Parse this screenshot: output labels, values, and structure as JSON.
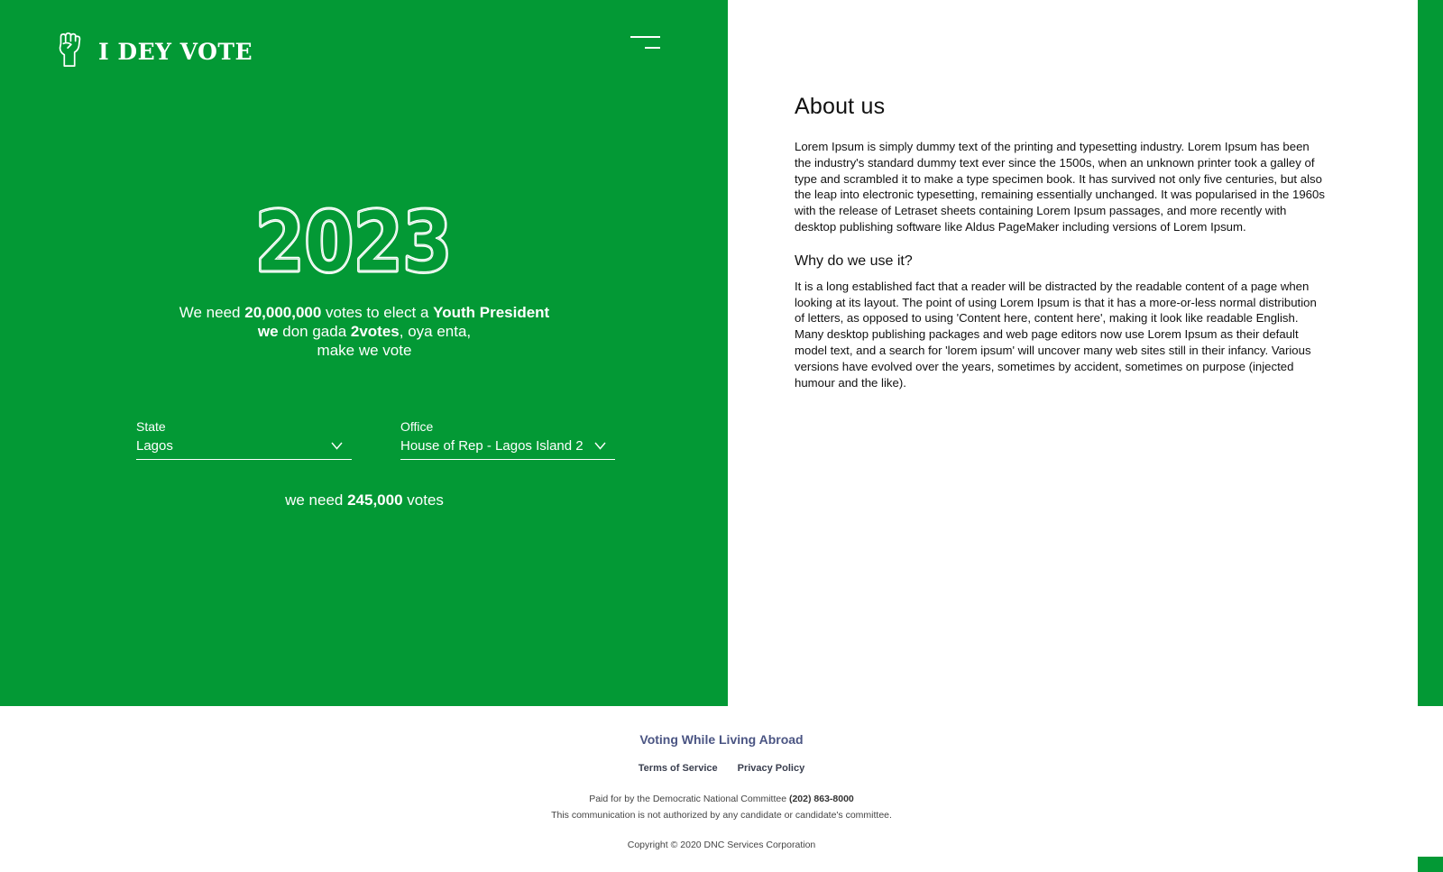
{
  "brand": {
    "name": "I DEY VOTE",
    "logo_icon": "raised-fist-icon"
  },
  "colors": {
    "brand_green": "#039935",
    "footer_link": "#4b5583"
  },
  "hero": {
    "year": "2023",
    "pitch": {
      "t1": "We need ",
      "b1": "20,000,000",
      "t2": " votes to elect a ",
      "b2": "Youth President",
      "b3": "we",
      "t3": " don gada ",
      "b4": "2votes",
      "t4": ", oya enta,",
      "t5": "make we vote"
    }
  },
  "form": {
    "state": {
      "label": "State",
      "value": "Lagos"
    },
    "office": {
      "label": "Office",
      "value": "House of Rep - Lagos Island 2"
    }
  },
  "need": {
    "prefix": "we need ",
    "number": "245,000",
    "suffix": " votes"
  },
  "about": {
    "title": "About us",
    "p1": "Lorem Ipsum is simply dummy text of the printing and typesetting industry. Lorem Ipsum has been the industry's standard dummy text ever since the 1500s, when an unknown printer took a galley of type and scrambled it to make a type specimen book. It has survived not only five centuries, but also the leap into electronic typesetting, remaining essentially unchanged. It was popularised in the 1960s with the release of Letraset sheets containing Lorem Ipsum passages, and more recently with desktop publishing software like Aldus PageMaker including versions of Lorem Ipsum.",
    "subtitle": "Why do we use it?",
    "p2": "It is a long established fact that a reader will be distracted by the readable content of a page when looking at its layout. The point of using Lorem Ipsum is that it has a more-or-less normal distribution of letters, as opposed to using 'Content here, content here', making it look like readable English. Many desktop publishing packages and web page editors now use Lorem Ipsum as their default model text, and a search for 'lorem ipsum' will uncover many web sites still in their infancy. Various versions have evolved over the years, sometimes by accident, sometimes on purpose (injected humour and the like)."
  },
  "footer": {
    "title": "Voting While Living Abroad",
    "links": {
      "terms": "Terms of Service",
      "privacy": "Privacy Policy"
    },
    "paid_prefix": "Paid for by the Democratic National Committee ",
    "paid_phone": "(202) 863-8000",
    "disclaimer": "This communication is not authorized by any candidate or candidate's committee.",
    "copyright": "Copyright © 2020 DNC Services Corporation"
  }
}
